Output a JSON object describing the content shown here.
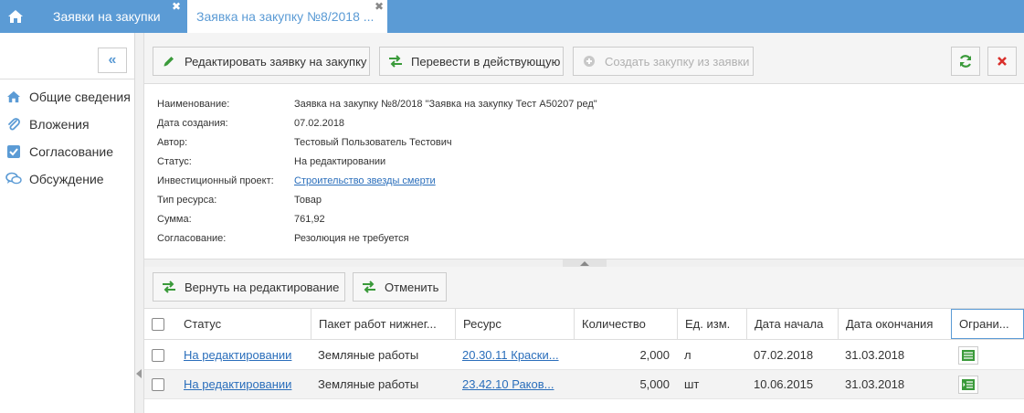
{
  "tabs": {
    "list_label": "Заявки на закупки",
    "active_label": "Заявка на закупку №8/2018 ...",
    "close_glyph": "✖"
  },
  "sidebar": {
    "collapse_glyph": "«",
    "items": [
      {
        "label": "Общие сведения",
        "icon": "home-icon"
      },
      {
        "label": "Вложения",
        "icon": "paperclip-icon"
      },
      {
        "label": "Согласование",
        "icon": "checkbox-icon"
      },
      {
        "label": "Обсуждение",
        "icon": "chat-icon"
      }
    ]
  },
  "toolbar": {
    "edit_label": "Редактировать заявку на закупку",
    "transfer_label": "Перевести в действующую",
    "create_label": "Создать закупку из заявки"
  },
  "details": {
    "name_label": "Наименование:",
    "name_value": "Заявка на закупку №8/2018 \"Заявка на закупку Тест А50207 ред\"",
    "created_label": "Дата создания:",
    "created_value": "07.02.2018",
    "author_label": "Автор:",
    "author_value": "Тестовый Пользователь Тестович",
    "status_label": "Статус:",
    "status_value": "На редактировании",
    "project_label": "Инвестиционный проект:",
    "project_value": "Строительство звезды смерти",
    "resource_type_label": "Тип ресурса:",
    "resource_type_value": "Товар",
    "sum_label": "Сумма:",
    "sum_value": "761,92",
    "approval_label": "Согласование:",
    "approval_value": "Резолюция не требуется"
  },
  "toolbar2": {
    "return_label": "Вернуть на редактирование",
    "cancel_label": "Отменить"
  },
  "grid": {
    "headers": {
      "status": "Статус",
      "package": "Пакет работ нижнег...",
      "resource": "Ресурс",
      "quantity": "Количество",
      "unit": "Ед. изм.",
      "start": "Дата начала",
      "end": "Дата окончания",
      "limit": "Ограни..."
    },
    "rows": [
      {
        "status": "На редактировании",
        "package": "Земляные работы",
        "resource": "20.30.11 Краски...",
        "quantity": "2,000",
        "unit": "л",
        "start": "07.02.2018",
        "end": "31.03.2018",
        "limit_icon": "list-icon"
      },
      {
        "status": "На редактировании",
        "package": "Земляные работы",
        "resource": "23.42.10 Раков...",
        "quantity": "5,000",
        "unit": "шт",
        "start": "10.06.2015",
        "end": "31.03.2018",
        "limit_icon": "indent-list-icon"
      }
    ]
  },
  "colors": {
    "accent": "#5b9bd5",
    "link": "#2a6ebb",
    "green": "#3a9a3a",
    "red": "#d9302c"
  }
}
